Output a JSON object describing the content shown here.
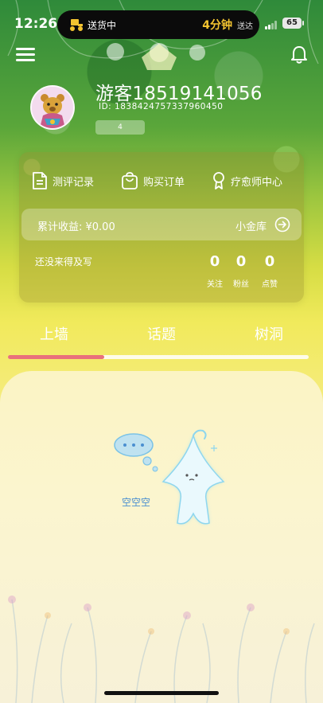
{
  "status_bar": {
    "time": "12:26",
    "delivery_text": "送货中",
    "eta_minutes": "4分钟",
    "eta_suffix": "送达",
    "battery": "65"
  },
  "header": {
    "menu_icon": "hamburger-menu-icon",
    "bell_icon": "bell-icon"
  },
  "profile": {
    "username": "游客18519141056",
    "user_id": "ID: 1838424757337960450",
    "level": "4"
  },
  "quick_nav": [
    {
      "label": "测评记录",
      "icon": "document-icon"
    },
    {
      "label": "购买订单",
      "icon": "shopping-bag-icon"
    },
    {
      "label": "疗愈师中心",
      "icon": "award-badge-icon"
    }
  ],
  "earnings": {
    "label": "累计收益: ¥0.00",
    "vault_label": "小金库"
  },
  "bio": "还没来得及写",
  "stats": [
    {
      "value": "0",
      "label": "关注"
    },
    {
      "value": "0",
      "label": "粉丝"
    },
    {
      "value": "0",
      "label": "点赞"
    }
  ],
  "tabs": [
    {
      "label": "上墙",
      "active": true
    },
    {
      "label": "话题",
      "active": false
    },
    {
      "label": "树洞",
      "active": false
    }
  ],
  "tab_progress": 0.32,
  "empty_state": {
    "text": "空空空"
  },
  "colors": {
    "tab_indicator": "#e9707b",
    "eta_accent": "#f4c430",
    "empty_text": "#4a8fd0"
  }
}
